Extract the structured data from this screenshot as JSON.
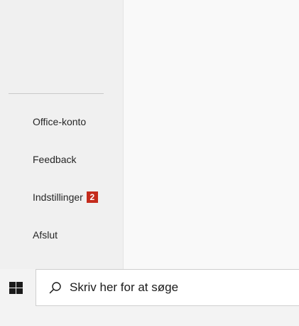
{
  "backstage": {
    "items": [
      {
        "label": "Office-konto"
      },
      {
        "label": "Feedback"
      },
      {
        "label": "Indstillinger",
        "badge": "2"
      },
      {
        "label": "Afslut"
      }
    ]
  },
  "taskbar": {
    "start_icon": "windows-logo-icon",
    "search_icon": "search-icon",
    "search_placeholder": "Skriv her for at søge"
  },
  "colors": {
    "badge": "#c42b1c",
    "nav_background": "#f0f0f0",
    "content_background": "#f9f9f9",
    "taskbar_background": "#f3f3f3"
  }
}
